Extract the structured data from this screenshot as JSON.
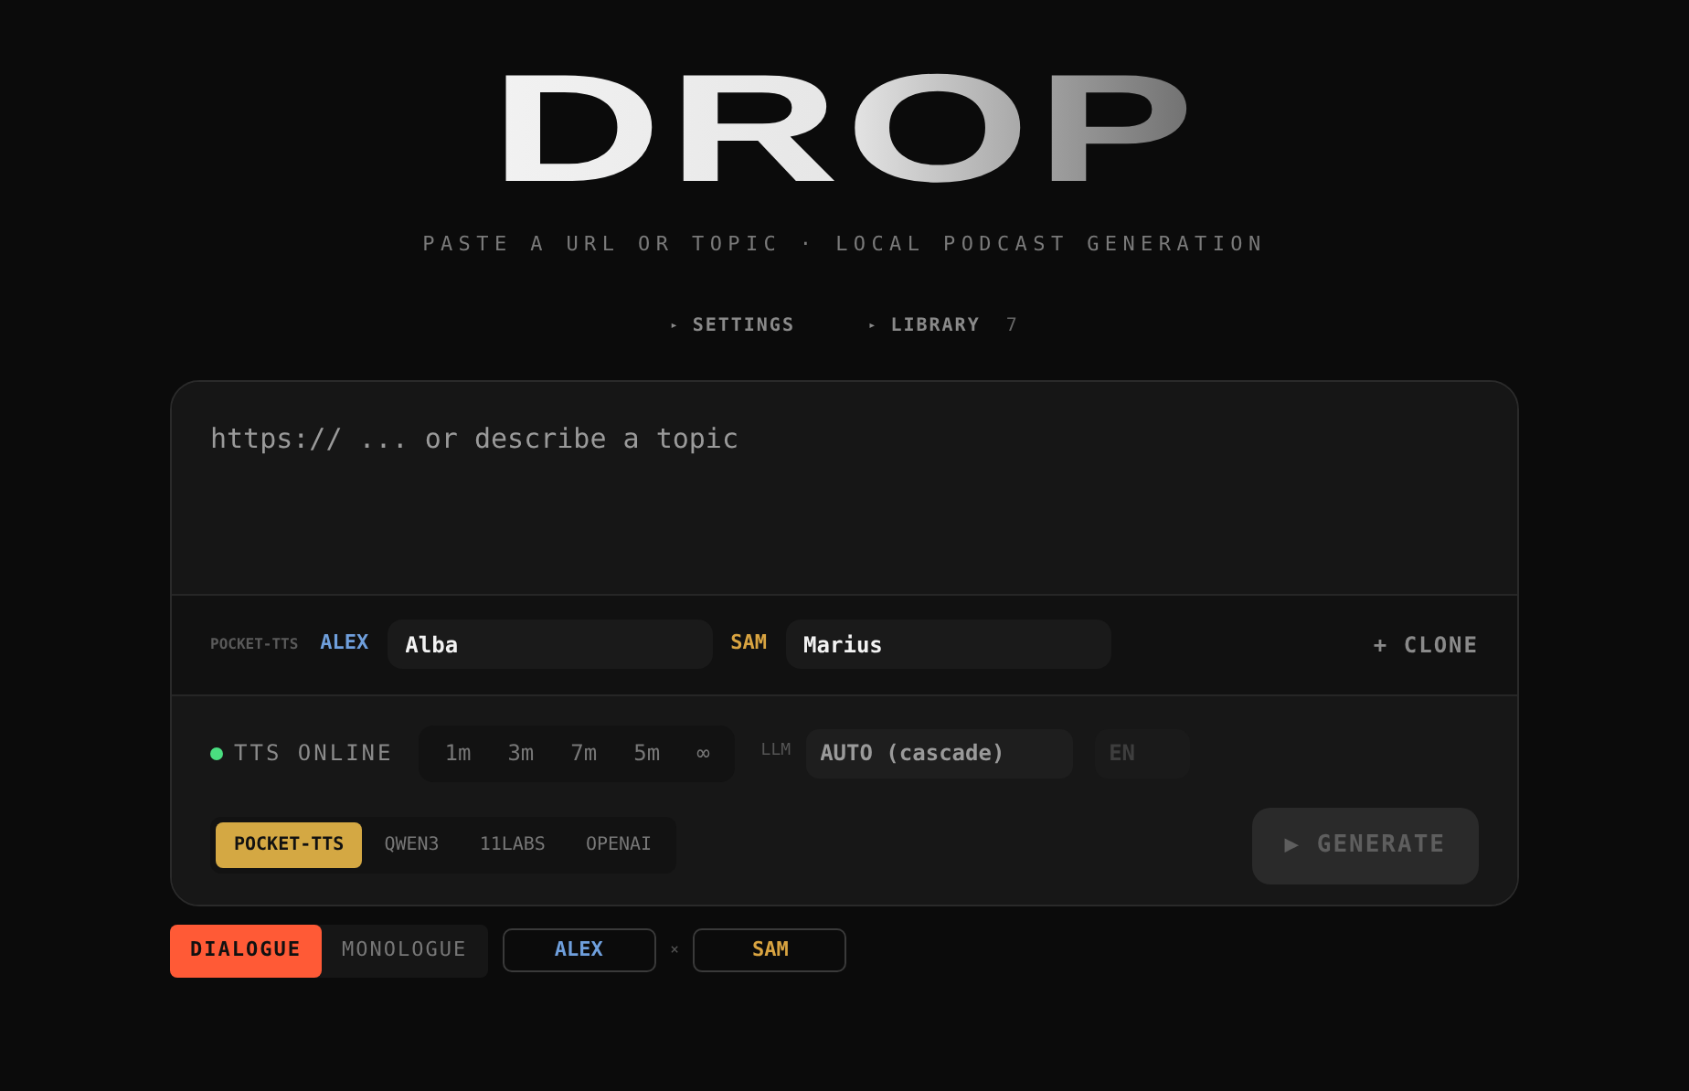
{
  "logo": "DROP",
  "tagline": "PASTE A URL OR TOPIC · LOCAL PODCAST GENERATION",
  "nav": [
    {
      "marker": "▸",
      "label": "SETTINGS"
    },
    {
      "marker": "▸",
      "label": "LIBRARY",
      "count": "7"
    }
  ],
  "prompt": {
    "placeholder": "https:// ... or describe a topic"
  },
  "voices": {
    "engine": "POCKET-TTS",
    "speakers": [
      {
        "name": "ALEX",
        "color": "#6f9fdc",
        "voice": "Alba"
      },
      {
        "name": "SAM",
        "color": "#d9a441",
        "voice": "Marius"
      }
    ],
    "clone": "+ CLONE"
  },
  "status": {
    "label": "TTS ONLINE",
    "online": true
  },
  "durations": [
    {
      "label": "1m",
      "selected": false
    },
    {
      "label": "3m",
      "selected": false
    },
    {
      "label": "7m",
      "selected": false
    },
    {
      "label": "5m",
      "selected": false
    },
    {
      "label": "∞",
      "selected": false
    }
  ],
  "llm": {
    "label": "LLM",
    "value": "AUTO (cascade)"
  },
  "language": {
    "placeholder": "EN"
  },
  "providers": [
    {
      "label": "POCKET-TTS",
      "selected": true
    },
    {
      "label": "QWEN3",
      "selected": false
    },
    {
      "label": "11LABS",
      "selected": false
    },
    {
      "label": "OPENAI",
      "selected": false
    }
  ],
  "generate": {
    "label": "▶ GENERATE",
    "disabled": true
  },
  "modes": [
    {
      "label": "DIALOGUE",
      "selected": true
    },
    {
      "label": "MONOLOGUE",
      "selected": false
    }
  ],
  "pair": {
    "left": "ALEX",
    "separator": "×",
    "right": "SAM"
  }
}
